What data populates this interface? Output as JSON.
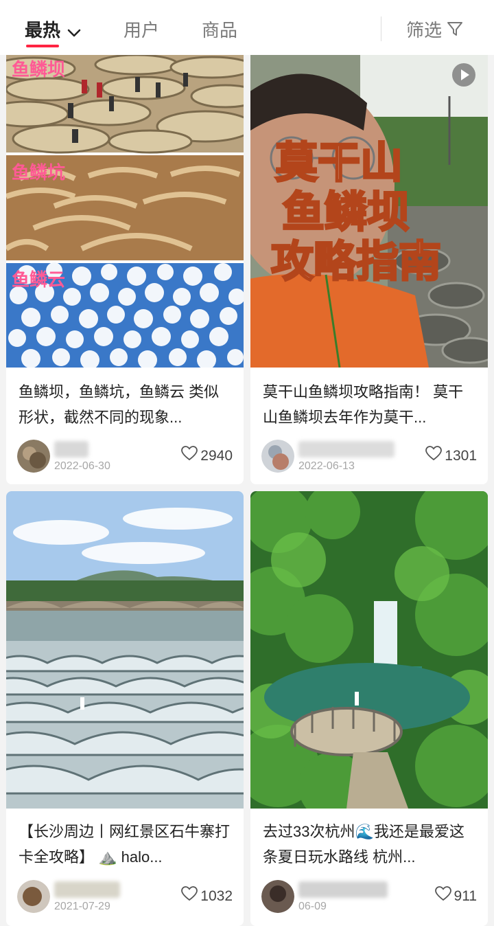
{
  "tabs": {
    "hot": "最热",
    "user": "用户",
    "goods": "商品",
    "filter": "筛选"
  },
  "posts": [
    {
      "title": "鱼鳞坝，鱼鳞坑，鱼鳞云 类似形状，截然不同的现象...",
      "date": "2022-06-30",
      "likes": "2940",
      "image_labels": [
        "鱼鳞坝",
        "鱼鳞坑",
        "鱼鳞云"
      ]
    },
    {
      "title": "莫干山鱼鳞坝攻略指南！ 莫干山鱼鳞坝去年作为莫干...",
      "date": "2022-06-13",
      "likes": "1301",
      "overlay_lines": [
        "莫干山",
        "鱼鳞坝",
        "攻略指南"
      ]
    },
    {
      "title": "【长沙周边丨网红景区石牛寨打卡全攻略】 ⛰️ halo...",
      "date": "2021-07-29",
      "likes": "1032"
    },
    {
      "title": "去过33次杭州🌊我还是最爱这条夏日玩水路线 杭州...",
      "date": "06-09",
      "likes": "911"
    }
  ],
  "colors": {
    "accent": "#ff2442",
    "label_pink": "#ff5a95"
  }
}
